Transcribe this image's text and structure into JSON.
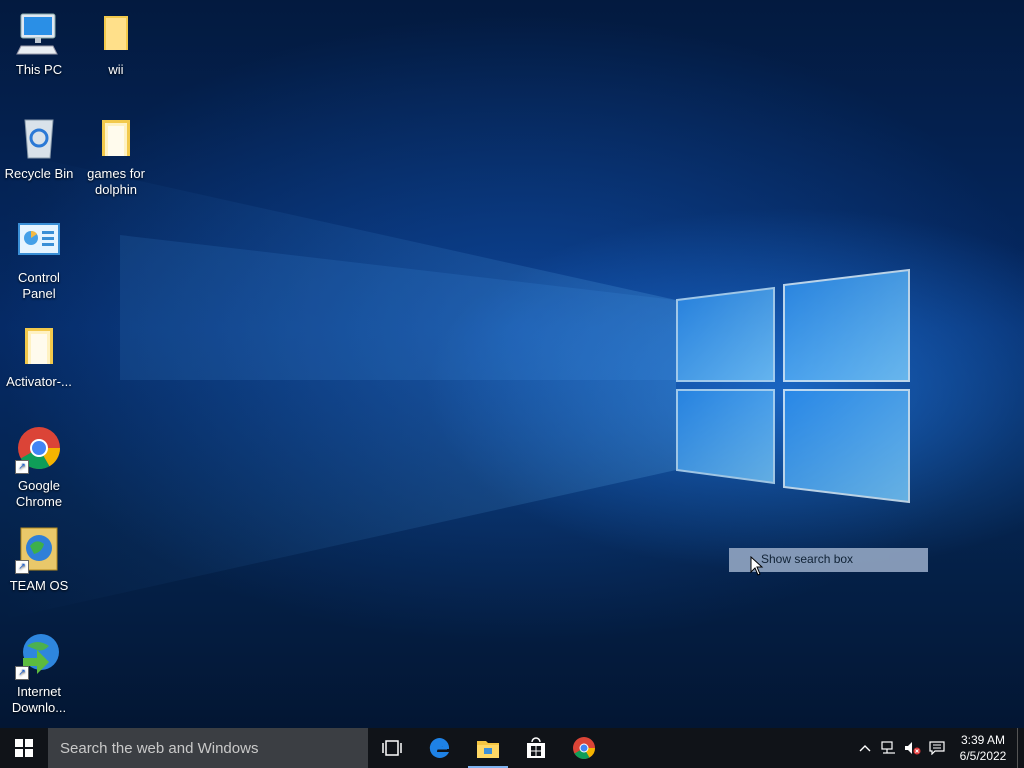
{
  "desktop": {
    "icons": [
      {
        "label": "This PC",
        "icon": "computer-icon"
      },
      {
        "label": "wii",
        "icon": "folder-icon"
      },
      {
        "label": "Recycle Bin",
        "icon": "recycle-bin-icon"
      },
      {
        "label": "games for dolphin",
        "icon": "folder-icon"
      },
      {
        "label": "Control Panel",
        "icon": "control-panel-icon"
      },
      {
        "label": "Activator-...",
        "icon": "folder-icon"
      },
      {
        "label": "Google Chrome",
        "icon": "chrome-icon",
        "shortcut": true
      },
      {
        "label": "TEAM OS",
        "icon": "team-os-icon",
        "shortcut": true
      },
      {
        "label": "Internet Downlo...",
        "icon": "idm-icon",
        "shortcut": true
      }
    ],
    "tooltip": "Show search box"
  },
  "taskbar": {
    "search_placeholder": "Search the web and Windows",
    "pinned": [
      {
        "name": "task-view",
        "icon": "task-view-icon"
      },
      {
        "name": "edge",
        "icon": "edge-icon"
      },
      {
        "name": "file-explorer",
        "icon": "file-explorer-icon",
        "active": true
      },
      {
        "name": "store",
        "icon": "store-icon"
      },
      {
        "name": "chrome",
        "icon": "chrome-icon"
      }
    ],
    "clock": {
      "time": "3:39 AM",
      "date": "6/5/2022"
    }
  },
  "colors": {
    "accent": "#1a7fe0",
    "taskbar": "#101318",
    "search_box": "#3b3e43"
  }
}
